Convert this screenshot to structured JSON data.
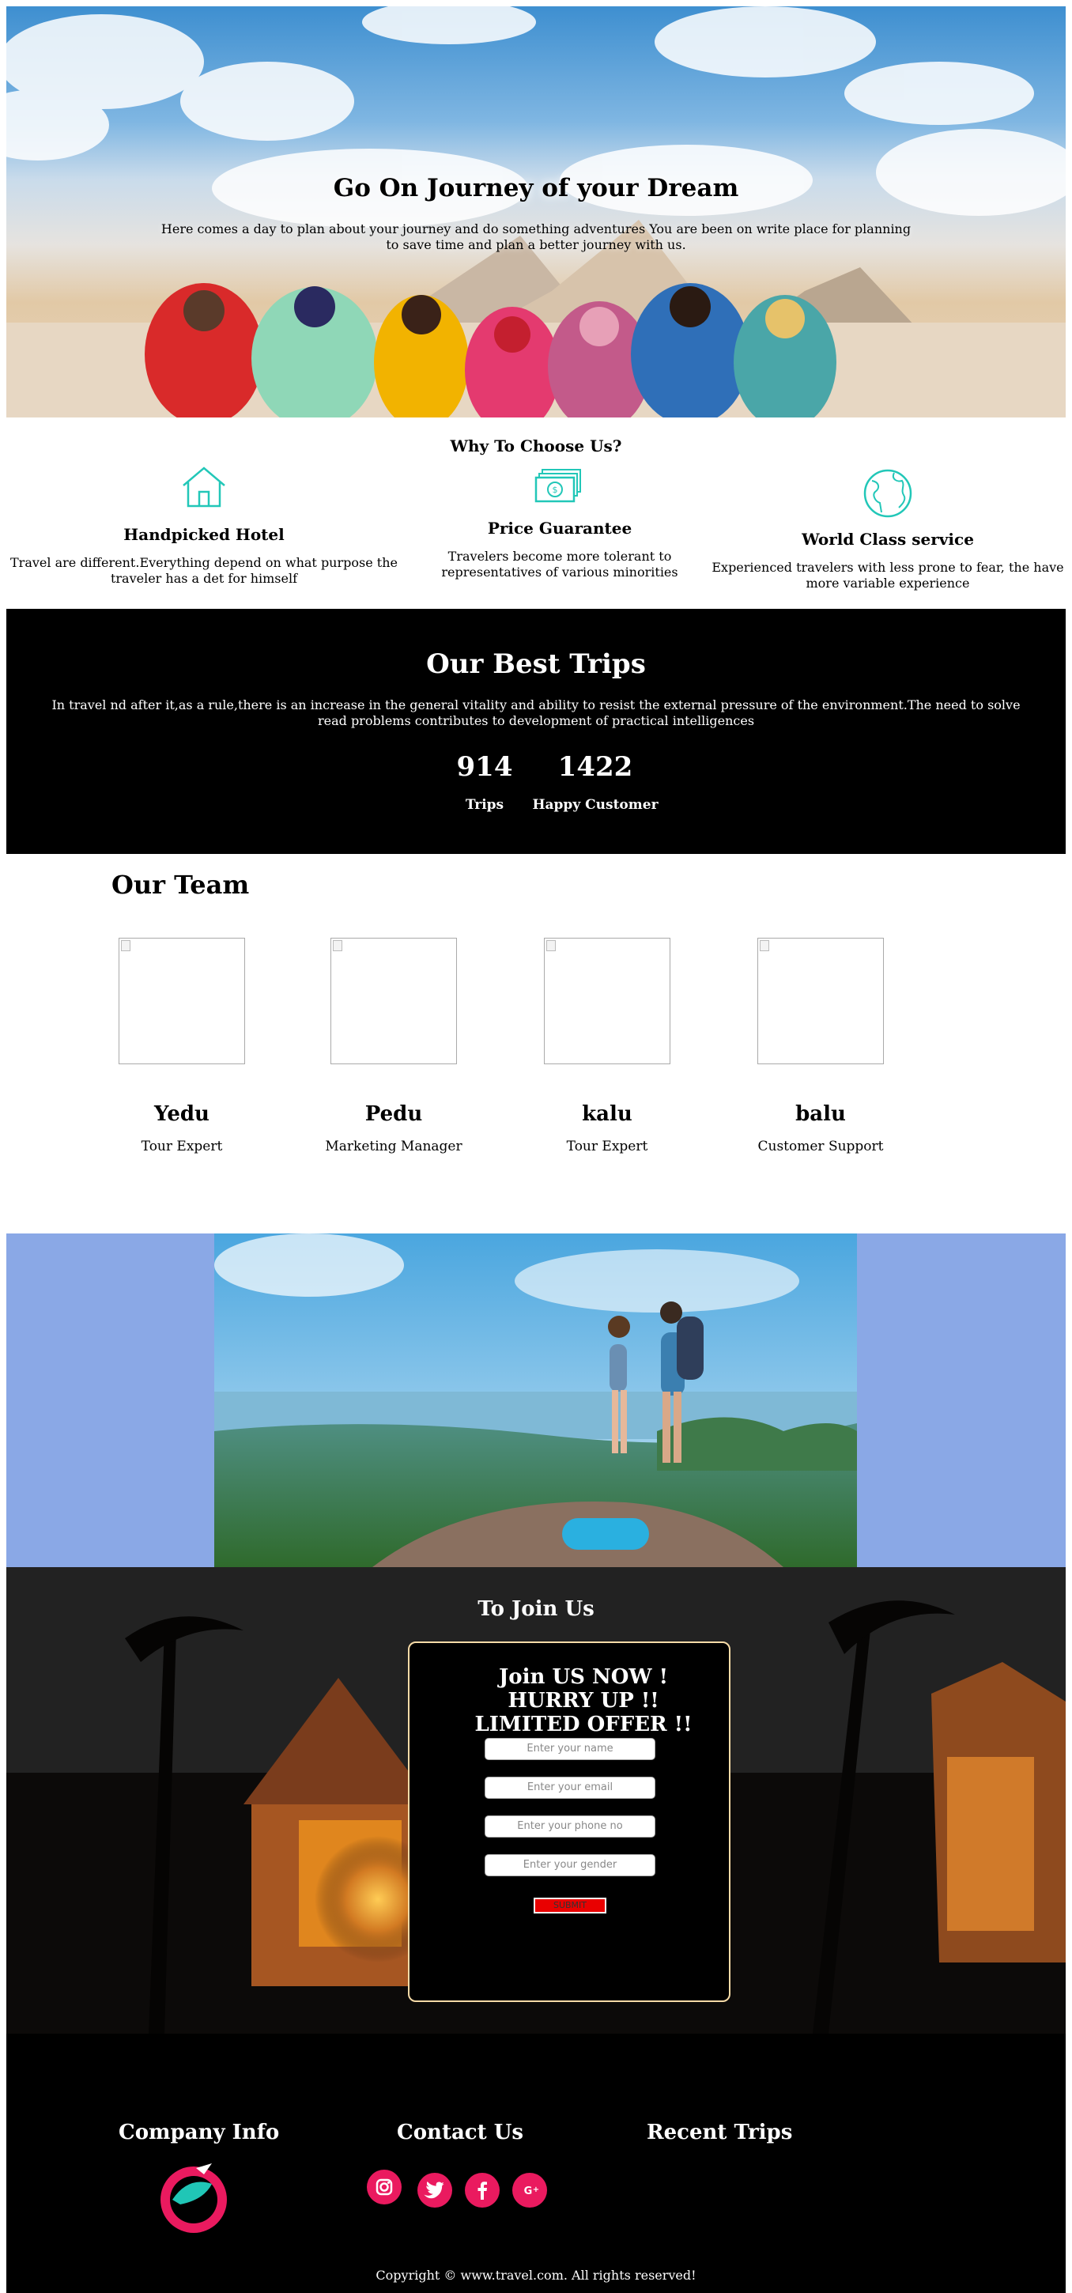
{
  "hero": {
    "title": "Go On Journey of your Dream",
    "subtitle": "Here comes a day to plan about your journey and do something adventures You are been on write place for planning to save time and plan a better journey with us."
  },
  "why": {
    "title": "Why To Choose Us?",
    "features": [
      {
        "icon": "house-icon",
        "title": "Handpicked Hotel",
        "text": "Travel are different.Everything depend on what purpose the traveler has a det for himself"
      },
      {
        "icon": "money-icon",
        "title": "Price Guarantee",
        "text": "Travelers become more tolerant to representatives of various minorities"
      },
      {
        "icon": "globe-icon",
        "title": "World Class service",
        "text": "Experienced travelers with less prone to fear, the have more variable experience"
      }
    ],
    "icon_color": "#22c7b8"
  },
  "trips": {
    "title": "Our Best Trips",
    "description": "In travel nd after it,as a rule,there is an increase in the general vitality and ability to resist the external pressure of the environment.The need to solve read problems contributes to development of practical intelligences",
    "stats": [
      {
        "number": "914",
        "label": "Trips"
      },
      {
        "number": "1422",
        "label": "Happy Customer"
      }
    ]
  },
  "team": {
    "title": "Our Team",
    "members": [
      {
        "name": "Yedu",
        "role": "Tour Expert"
      },
      {
        "name": "Pedu",
        "role": "Marketing Manager"
      },
      {
        "name": "kalu",
        "role": "Tour Expert"
      },
      {
        "name": "balu",
        "role": "Customer Support"
      }
    ]
  },
  "adventure": {
    "background_color": "#8aa8e6"
  },
  "join": {
    "title": "To Join Us",
    "offer_lines": [
      "Join US NOW !",
      "HURRY UP !!",
      "LIMITED OFFER !!"
    ],
    "fields": {
      "name_placeholder": "Enter your name",
      "email_placeholder": "Enter your email",
      "phone_placeholder": "Enter your phone no",
      "gender_placeholder": "Enter your gender"
    },
    "submit_label": "SUBMIT",
    "border_color": "#f7dba7",
    "submit_color": "#e90000"
  },
  "footer": {
    "company_info": "Company Info",
    "contact_us": "Contact Us",
    "recent_trips": "Recent Trips",
    "social_icons": [
      "instagram-icon",
      "twitter-icon",
      "facebook-icon",
      "google-plus-icon"
    ],
    "social_color": "#ea1a5f",
    "copyright": "Copyright © www.travel.com. All rights reserved!"
  }
}
